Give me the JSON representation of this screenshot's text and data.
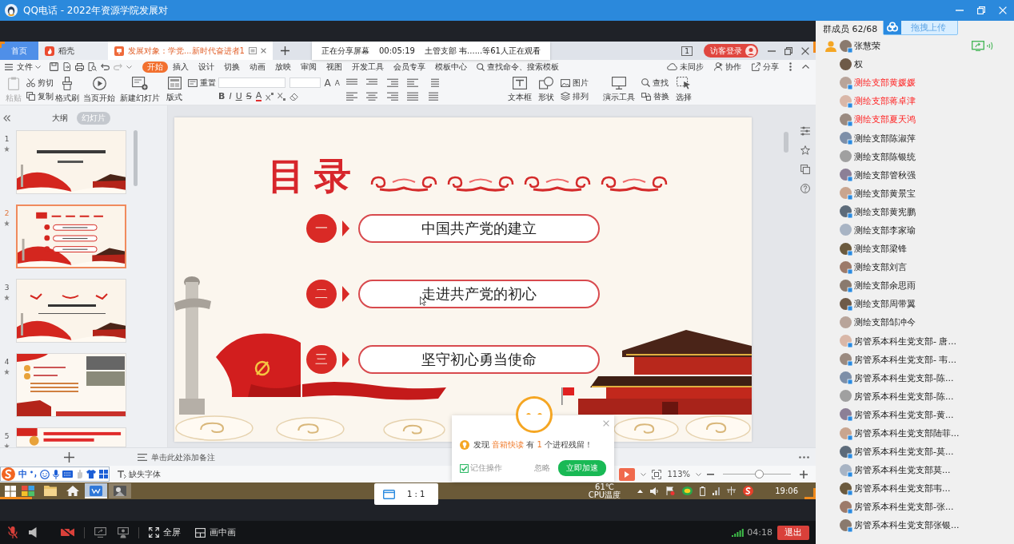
{
  "window": {
    "title": "QQ电话 - 2022年资源学院发展对"
  },
  "shared_screen": {
    "sharing_banner": {
      "status": "正在分享屏幕",
      "duration": "00:05:19",
      "viewers": "土管支部 韦......等61人正在观看"
    },
    "tabs": [
      {
        "label": "首页",
        "kind": "home",
        "selected": false
      },
      {
        "label": "稻壳",
        "kind": "docer",
        "selected": false
      },
      {
        "label": "发展对象：学党...新时代奋进者1",
        "kind": "document",
        "selected": true
      }
    ],
    "window_count": "1",
    "login": "访客登录",
    "menu": {
      "file": "文件",
      "items": [
        {
          "label": "开始",
          "selected": true
        },
        {
          "label": "插入",
          "selected": false
        },
        {
          "label": "设计",
          "selected": false
        },
        {
          "label": "切换",
          "selected": false
        },
        {
          "label": "动画",
          "selected": false
        },
        {
          "label": "放映",
          "selected": false
        },
        {
          "label": "审阅",
          "selected": false
        },
        {
          "label": "视图",
          "selected": false
        },
        {
          "label": "开发工具",
          "selected": false
        },
        {
          "label": "会员专享",
          "selected": false
        },
        {
          "label": "模板中心",
          "selected": false
        }
      ],
      "search": {
        "placeholder": "查找命令、搜索模板"
      },
      "actions": [
        "未同步",
        "协作",
        "分享"
      ]
    },
    "toolbar": {
      "clipboard": [
        {
          "label": "粘贴",
          "disabled": true
        },
        {
          "label": "剪切",
          "disabled": false
        },
        {
          "label": "复制",
          "disabled": false
        },
        {
          "label": "格式刷",
          "disabled": false
        }
      ],
      "slides": [
        "当页开始",
        "新建幻灯片",
        "版式",
        "重置"
      ],
      "font_size_buttons": [
        "A",
        "A"
      ],
      "format_buttons": [
        "B",
        "I",
        "U",
        "S",
        "A"
      ],
      "insert": [
        "文本框",
        "形状",
        "图片",
        "排列"
      ],
      "tools": [
        "演示工具",
        "查找",
        "替换",
        "选择"
      ]
    },
    "panel_tabs": [
      {
        "label": "大纲",
        "selected": false
      },
      {
        "label": "幻灯片",
        "selected": true
      }
    ],
    "slides": [
      {
        "number": "1",
        "selected": false
      },
      {
        "number": "2",
        "selected": true
      },
      {
        "number": "3",
        "selected": false
      },
      {
        "number": "4",
        "selected": false
      },
      {
        "number": "5",
        "selected": false
      }
    ],
    "slide": {
      "title": "目录",
      "items": [
        {
          "number": "一",
          "label": "中国共产党的建立"
        },
        {
          "number": "二",
          "label": "走进共产党的初心"
        },
        {
          "number": "三",
          "label": "坚守初心勇当使命"
        }
      ]
    },
    "notes": {
      "placeholder": "单击此处添加备注"
    },
    "status_bar": {
      "ime_mode": "中",
      "missing_fonts": "缺失字体",
      "zoom": "113%",
      "zoom_slider": {
        "level": 0.53
      }
    },
    "popup": {
      "message": "发现 **音箱快读** 有 **1** 个进程残留！",
      "remember": {
        "label": "记住操作",
        "checked": true
      },
      "ignore": "忽略",
      "action": "立即加速"
    },
    "taskbar": {
      "apps": [
        {
          "selected": false,
          "open": false
        },
        {
          "selected": false,
          "open": false
        },
        {
          "selected": false,
          "open": false
        },
        {
          "selected": true,
          "open": true
        },
        {
          "selected": false,
          "open": true
        }
      ],
      "temperature": "61℃",
      "temperature_label": "CPU温度",
      "time": "19:06"
    }
  },
  "ratio_popup": {
    "label": "1 : 1"
  },
  "call_bar": {
    "mic_muted": true,
    "camera_off": true,
    "buttons": [
      "全屏",
      "画中画"
    ],
    "duration": "04:18",
    "leave": "退出"
  },
  "members_panel": {
    "title": "群成员 62/68",
    "upload": "拖拽上传",
    "members": [
      {
        "name": "张慧荣",
        "highlighted": false,
        "badge": true,
        "host": true,
        "sharing": true
      },
      {
        "name": "权",
        "highlighted": false,
        "badge": false,
        "host": false,
        "sharing": false
      },
      {
        "name": "测绘支部黄媛媛",
        "highlighted": true,
        "badge": true,
        "host": false,
        "sharing": false
      },
      {
        "name": "测绘支部蒋卓津",
        "highlighted": true,
        "badge": true,
        "host": false,
        "sharing": false
      },
      {
        "name": "测绘支部夏天鸿",
        "highlighted": true,
        "badge": true,
        "host": false,
        "sharing": false
      },
      {
        "name": "测绘支部陈淑萍",
        "highlighted": false,
        "badge": true,
        "host": false,
        "sharing": false
      },
      {
        "name": "测绘支部陈银统",
        "highlighted": false,
        "badge": false,
        "host": false,
        "sharing": false
      },
      {
        "name": "测绘支部管秋强",
        "highlighted": false,
        "badge": true,
        "host": false,
        "sharing": false
      },
      {
        "name": "测绘支部黄景宝",
        "highlighted": false,
        "badge": true,
        "host": false,
        "sharing": false
      },
      {
        "name": "测绘支部黄宪鹏",
        "highlighted": false,
        "badge": true,
        "host": false,
        "sharing": false
      },
      {
        "name": "测绘支部李家瑜",
        "highlighted": false,
        "badge": false,
        "host": false,
        "sharing": false
      },
      {
        "name": "测绘支部梁锋",
        "highlighted": false,
        "badge": true,
        "host": false,
        "sharing": false
      },
      {
        "name": "测绘支部刘言",
        "highlighted": false,
        "badge": true,
        "host": false,
        "sharing": false
      },
      {
        "name": "测绘支部余思雨",
        "highlighted": false,
        "badge": true,
        "host": false,
        "sharing": false
      },
      {
        "name": "测绘支部周带翼",
        "highlighted": false,
        "badge": true,
        "host": false,
        "sharing": false
      },
      {
        "name": "测绘支部邹冲今",
        "highlighted": false,
        "badge": false,
        "host": false,
        "sharing": false
      },
      {
        "name": "房管系本科生党支部- 唐...",
        "highlighted": false,
        "badge": true,
        "host": false,
        "sharing": false
      },
      {
        "name": "房管系本科生党支部- 韦...",
        "highlighted": false,
        "badge": true,
        "host": false,
        "sharing": false
      },
      {
        "name": "房管系本科生党支部-陈...",
        "highlighted": false,
        "badge": true,
        "host": false,
        "sharing": false
      },
      {
        "name": "房管系本科生党支部-陈...",
        "highlighted": false,
        "badge": false,
        "host": false,
        "sharing": false
      },
      {
        "name": "房管系本科生党支部-黄...",
        "highlighted": false,
        "badge": true,
        "host": false,
        "sharing": false
      },
      {
        "name": "房管系本科生党支部陆菲...",
        "highlighted": false,
        "badge": true,
        "host": false,
        "sharing": false
      },
      {
        "name": "房管系本科生党支部-莫...",
        "highlighted": false,
        "badge": true,
        "host": false,
        "sharing": false
      },
      {
        "name": "房管系本科生党支部莫...",
        "highlighted": false,
        "badge": true,
        "host": false,
        "sharing": false
      },
      {
        "name": "房管系本科生党支部韦...",
        "highlighted": false,
        "badge": true,
        "host": false,
        "sharing": false
      },
      {
        "name": "房管系本科生党支部-张...",
        "highlighted": false,
        "badge": true,
        "host": false,
        "sharing": false
      },
      {
        "name": "房管系本科生党支部张银...",
        "highlighted": false,
        "badge": true,
        "host": false,
        "sharing": false
      }
    ]
  }
}
